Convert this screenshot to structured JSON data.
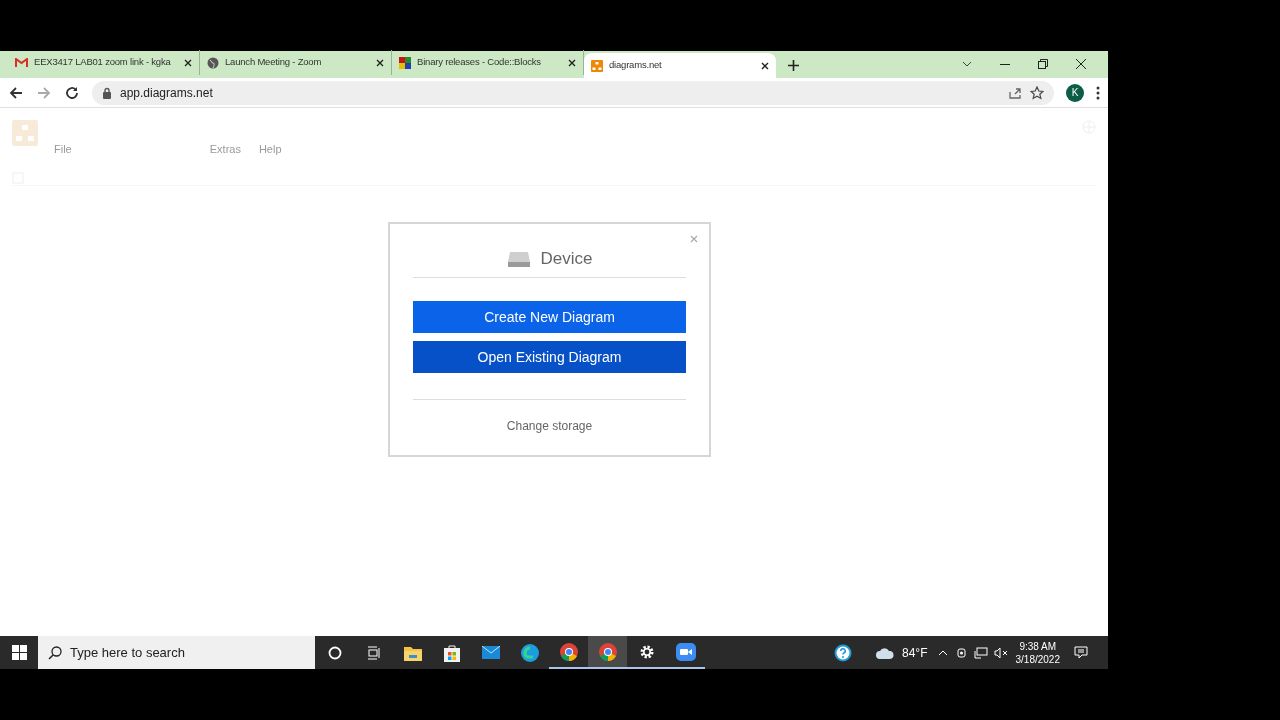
{
  "tabs": [
    {
      "label": "EEX3417 LAB01 zoom link - kgka",
      "kind": "mail",
      "selected": false
    },
    {
      "label": "Launch Meeting - Zoom",
      "kind": "globe",
      "selected": false
    },
    {
      "label": "Binary releases - Code::Blocks",
      "kind": "blocks",
      "selected": false
    },
    {
      "label": "diagrams.net",
      "kind": "drawio",
      "selected": true
    }
  ],
  "address_bar": {
    "url": "app.diagrams.net",
    "avatar": "K"
  },
  "app": {
    "menu": [
      "File",
      "Extras",
      "Help"
    ]
  },
  "dialog": {
    "title": "Device",
    "buttons": [
      "Create New Diagram",
      "Open Existing Diagram"
    ],
    "link": "Change storage"
  },
  "taskbar": {
    "search_placeholder": "Type here to search",
    "apps": [
      {
        "kind": "cortana",
        "running": false,
        "selected": false
      },
      {
        "kind": "taskview",
        "running": false,
        "selected": false
      },
      {
        "kind": "folder",
        "running": false,
        "selected": false
      },
      {
        "kind": "store",
        "running": false,
        "selected": false
      },
      {
        "kind": "mail",
        "running": false,
        "selected": false
      },
      {
        "kind": "edge",
        "running": false,
        "selected": false
      },
      {
        "kind": "chrome",
        "running": true,
        "selected": false
      },
      {
        "kind": "chrome",
        "running": true,
        "selected": true
      },
      {
        "kind": "gear",
        "running": true,
        "selected": false
      },
      {
        "kind": "zoom",
        "running": true,
        "selected": false
      }
    ],
    "weather": "84°F",
    "time": "9:38 AM",
    "date": "3/18/2022"
  }
}
